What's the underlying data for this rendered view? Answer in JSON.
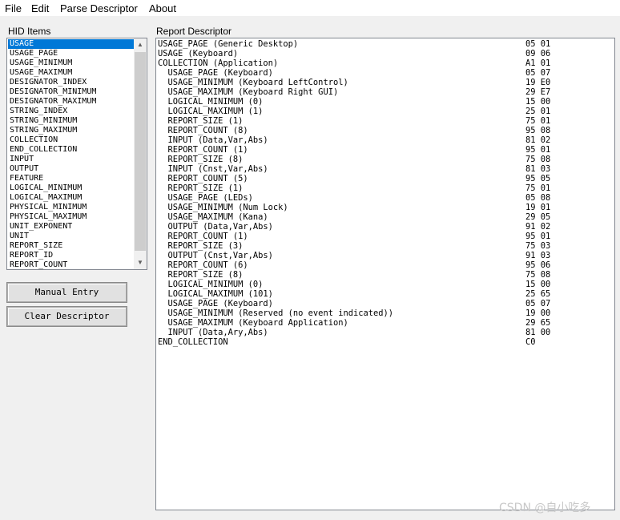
{
  "menu": {
    "file": "File",
    "edit": "Edit",
    "parse": "Parse Descriptor",
    "about": "About"
  },
  "hid_items_label": "HID Items",
  "report_label": "Report Descriptor",
  "hid_items": [
    "USAGE",
    "USAGE_PAGE",
    "USAGE_MINIMUM",
    "USAGE_MAXIMUM",
    "DESIGNATOR_INDEX",
    "DESIGNATOR_MINIMUM",
    "DESIGNATOR_MAXIMUM",
    "STRING_INDEX",
    "STRING_MINIMUM",
    "STRING_MAXIMUM",
    "COLLECTION",
    "END_COLLECTION",
    "INPUT",
    "OUTPUT",
    "FEATURE",
    "LOGICAL_MINIMUM",
    "LOGICAL_MAXIMUM",
    "PHYSICAL_MINIMUM",
    "PHYSICAL_MAXIMUM",
    "UNIT_EXPONENT",
    "UNIT",
    "REPORT_SIZE",
    "REPORT_ID",
    "REPORT_COUNT"
  ],
  "selected_hid_item": "USAGE",
  "buttons": {
    "manual_entry": "Manual Entry",
    "clear_descriptor": "Clear Descriptor"
  },
  "report_rows": [
    {
      "desc": "USAGE_PAGE (Generic Desktop)",
      "hex": "05 01"
    },
    {
      "desc": "USAGE (Keyboard)",
      "hex": "09 06"
    },
    {
      "desc": "COLLECTION (Application)",
      "hex": "A1 01"
    },
    {
      "desc": "  USAGE_PAGE (Keyboard)",
      "hex": "05 07"
    },
    {
      "desc": "  USAGE_MINIMUM (Keyboard LeftControl)",
      "hex": "19 E0"
    },
    {
      "desc": "  USAGE_MAXIMUM (Keyboard Right GUI)",
      "hex": "29 E7"
    },
    {
      "desc": "  LOGICAL_MINIMUM (0)",
      "hex": "15 00"
    },
    {
      "desc": "  LOGICAL_MAXIMUM (1)",
      "hex": "25 01"
    },
    {
      "desc": "  REPORT_SIZE (1)",
      "hex": "75 01"
    },
    {
      "desc": "  REPORT_COUNT (8)",
      "hex": "95 08"
    },
    {
      "desc": "  INPUT (Data,Var,Abs)",
      "hex": "81 02"
    },
    {
      "desc": "  REPORT_COUNT (1)",
      "hex": "95 01"
    },
    {
      "desc": "  REPORT_SIZE (8)",
      "hex": "75 08"
    },
    {
      "desc": "  INPUT (Cnst,Var,Abs)",
      "hex": "81 03"
    },
    {
      "desc": "  REPORT_COUNT (5)",
      "hex": "95 05"
    },
    {
      "desc": "  REPORT_SIZE (1)",
      "hex": "75 01"
    },
    {
      "desc": "  USAGE_PAGE (LEDs)",
      "hex": "05 08"
    },
    {
      "desc": "  USAGE_MINIMUM (Num Lock)",
      "hex": "19 01"
    },
    {
      "desc": "  USAGE_MAXIMUM (Kana)",
      "hex": "29 05"
    },
    {
      "desc": "  OUTPUT (Data,Var,Abs)",
      "hex": "91 02"
    },
    {
      "desc": "  REPORT_COUNT (1)",
      "hex": "95 01"
    },
    {
      "desc": "  REPORT_SIZE (3)",
      "hex": "75 03"
    },
    {
      "desc": "  OUTPUT (Cnst,Var,Abs)",
      "hex": "91 03"
    },
    {
      "desc": "  REPORT_COUNT (6)",
      "hex": "95 06"
    },
    {
      "desc": "  REPORT_SIZE (8)",
      "hex": "75 08"
    },
    {
      "desc": "  LOGICAL_MINIMUM (0)",
      "hex": "15 00"
    },
    {
      "desc": "  LOGICAL_MAXIMUM (101)",
      "hex": "25 65"
    },
    {
      "desc": "  USAGE_PAGE (Keyboard)",
      "hex": "05 07"
    },
    {
      "desc": "  USAGE_MINIMUM (Reserved (no event indicated))",
      "hex": "19 00"
    },
    {
      "desc": "  USAGE_MAXIMUM (Keyboard Application)",
      "hex": "29 65"
    },
    {
      "desc": "  INPUT (Data,Ary,Abs)",
      "hex": "81 00"
    },
    {
      "desc": "END_COLLECTION",
      "hex": "C0"
    }
  ],
  "scroll_icons": {
    "up": "chevron-up-icon",
    "down": "chevron-down-icon"
  },
  "watermark": "CSDN @自小吃多",
  "colors": {
    "selection": "#0078d7",
    "background": "#f0f0f0"
  }
}
